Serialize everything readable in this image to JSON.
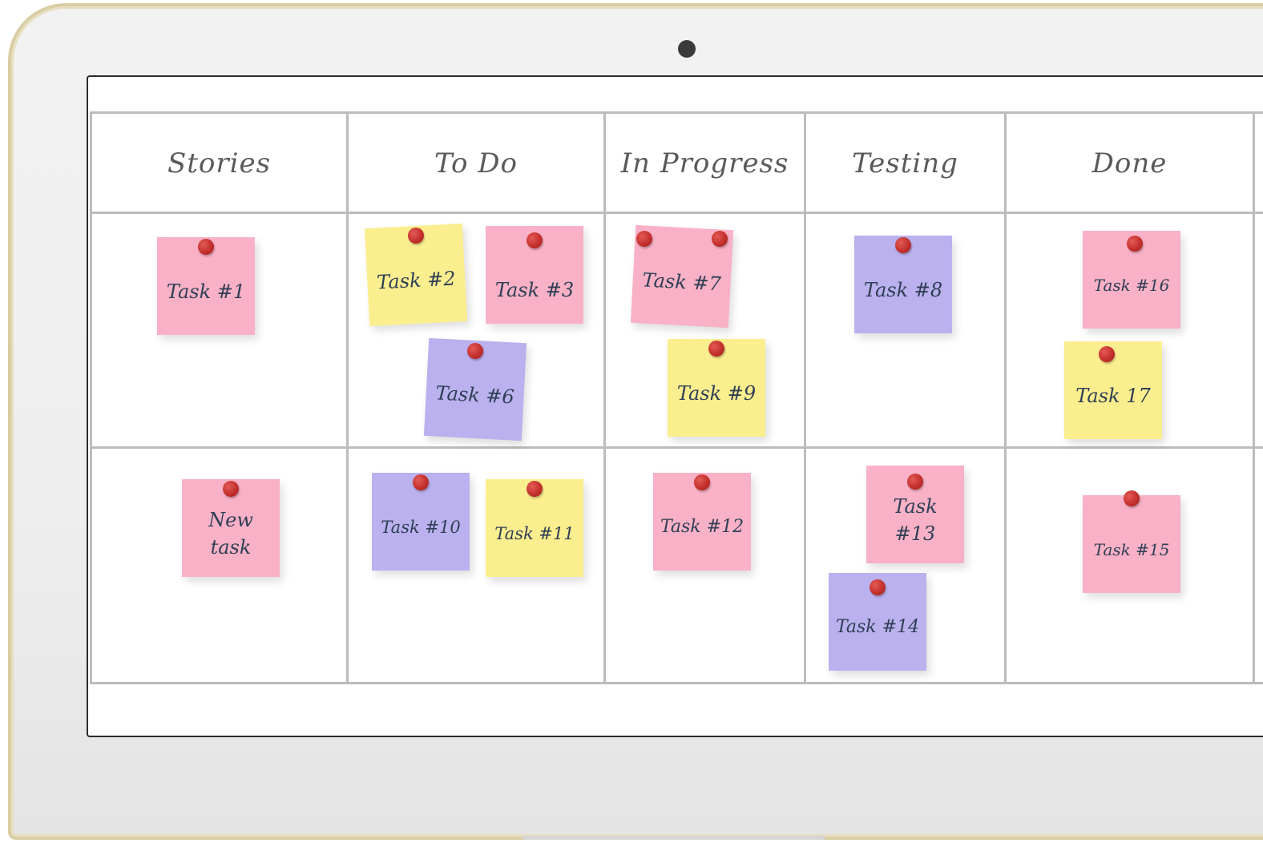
{
  "board": {
    "columns": [
      "Stories",
      "To Do",
      "In Progress",
      "Testing",
      "Done"
    ],
    "notes": {
      "task1": "Task #1",
      "task2": "Task #2",
      "task3": "Task #3",
      "task6": "Task #6",
      "task7": "Task #7",
      "task8": "Task #8",
      "task9": "Task #9",
      "task16": "Task #16",
      "task17": "Task 17",
      "new_task": "New task",
      "task10": "Task #10",
      "task11": "Task #11",
      "task12": "Task #12",
      "task13": "Task #13",
      "task14": "Task #14",
      "task15": "Task #15"
    }
  },
  "colors": {
    "pink": "#f8b1c6",
    "yellow": "#fbee8e",
    "purple": "#bab1ee",
    "pin": "#c4302d"
  }
}
